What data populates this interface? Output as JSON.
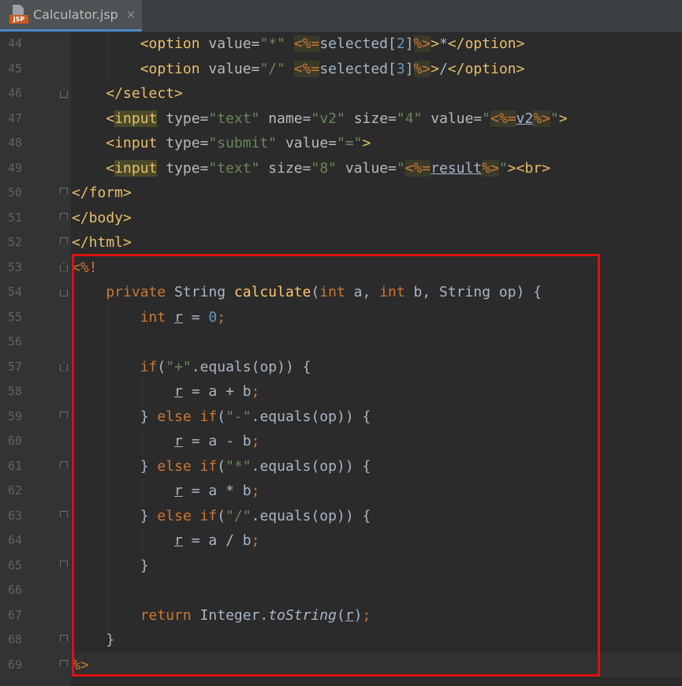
{
  "tab": {
    "title": "Calculator.jsp",
    "close": "✕",
    "icon_label": "JSP"
  },
  "line_numbers": [
    "44",
    "45",
    "46",
    "47",
    "48",
    "49",
    "50",
    "51",
    "52",
    "53",
    "54",
    "55",
    "56",
    "57",
    "58",
    "59",
    "60",
    "61",
    "62",
    "63",
    "64",
    "65",
    "66",
    "67",
    "68",
    "69"
  ],
  "lines": [
    {
      "n": 0,
      "indent": 8,
      "tokens": [
        [
          "tag",
          "<option"
        ],
        [
          "plain",
          " "
        ],
        [
          "attr",
          "value="
        ],
        [
          "str",
          "\"*\""
        ],
        [
          "plain",
          " "
        ],
        [
          "jspd",
          "<%="
        ],
        [
          "plain",
          "selected["
        ],
        [
          "num",
          "2"
        ],
        [
          "plain",
          "]"
        ],
        [
          "jspd",
          "%>"
        ],
        [
          "tag",
          ">"
        ],
        [
          "plain",
          "*"
        ],
        [
          "tag",
          "</option>"
        ]
      ]
    },
    {
      "n": 1,
      "indent": 8,
      "tokens": [
        [
          "tag",
          "<option"
        ],
        [
          "plain",
          " "
        ],
        [
          "attr",
          "value="
        ],
        [
          "str",
          "\"/\""
        ],
        [
          "plain",
          " "
        ],
        [
          "jspd",
          "<%="
        ],
        [
          "plain",
          "selected["
        ],
        [
          "num",
          "3"
        ],
        [
          "plain",
          "]"
        ],
        [
          "jspd",
          "%>"
        ],
        [
          "tag",
          ">"
        ],
        [
          "plain",
          "/"
        ],
        [
          "tag",
          "</option>"
        ]
      ]
    },
    {
      "n": 2,
      "indent": 4,
      "tokens": [
        [
          "tag",
          "</select>"
        ]
      ]
    },
    {
      "n": 3,
      "indent": 4,
      "tokens": [
        [
          "tag",
          "<"
        ],
        [
          "hl tag",
          "input"
        ],
        [
          "plain",
          " "
        ],
        [
          "attr",
          "type="
        ],
        [
          "str",
          "\"text\""
        ],
        [
          "plain",
          " "
        ],
        [
          "attr",
          "name="
        ],
        [
          "str",
          "\"v2\""
        ],
        [
          "plain",
          " "
        ],
        [
          "attr",
          "size="
        ],
        [
          "str",
          "\"4\""
        ],
        [
          "plain",
          " "
        ],
        [
          "attr",
          "value="
        ],
        [
          "str",
          "\""
        ],
        [
          "jspd",
          "<%="
        ],
        [
          "var plain",
          "v2"
        ],
        [
          "jspd",
          "%>"
        ],
        [
          "str",
          "\""
        ],
        [
          "tag",
          ">"
        ]
      ]
    },
    {
      "n": 4,
      "indent": 4,
      "tokens": [
        [
          "tag",
          "<input"
        ],
        [
          "plain",
          " "
        ],
        [
          "attr",
          "type="
        ],
        [
          "str",
          "\"submit\""
        ],
        [
          "plain",
          " "
        ],
        [
          "attr",
          "value="
        ],
        [
          "str",
          "\"=\""
        ],
        [
          "tag",
          ">"
        ]
      ]
    },
    {
      "n": 5,
      "indent": 4,
      "tokens": [
        [
          "tag",
          "<"
        ],
        [
          "hl tag",
          "input"
        ],
        [
          "plain",
          " "
        ],
        [
          "attr",
          "type="
        ],
        [
          "str",
          "\"text\""
        ],
        [
          "plain",
          " "
        ],
        [
          "attr",
          "size="
        ],
        [
          "str",
          "\"8\""
        ],
        [
          "plain",
          " "
        ],
        [
          "attr",
          "value="
        ],
        [
          "str",
          "\""
        ],
        [
          "jspd",
          "<%="
        ],
        [
          "var plain",
          "result"
        ],
        [
          "jspd",
          "%>"
        ],
        [
          "str",
          "\""
        ],
        [
          "tag",
          "><br>"
        ]
      ]
    },
    {
      "n": 6,
      "indent": 0,
      "tokens": [
        [
          "tag",
          "</form>"
        ]
      ]
    },
    {
      "n": 7,
      "indent": 0,
      "tokens": [
        [
          "tag",
          "</body>"
        ]
      ]
    },
    {
      "n": 8,
      "indent": 0,
      "tokens": [
        [
          "tag",
          "</html>"
        ]
      ]
    },
    {
      "n": 9,
      "indent": 0,
      "tokens": [
        [
          "kw",
          "<%!"
        ]
      ]
    },
    {
      "n": 10,
      "indent": 4,
      "tokens": [
        [
          "kw",
          "private"
        ],
        [
          "plain",
          " String "
        ],
        [
          "fn",
          "calculate"
        ],
        [
          "plain",
          "("
        ],
        [
          "kw",
          "int"
        ],
        [
          "plain",
          " a, "
        ],
        [
          "kw",
          "int"
        ],
        [
          "plain",
          " b, String op) {"
        ]
      ]
    },
    {
      "n": 11,
      "indent": 8,
      "tokens": [
        [
          "kw",
          "int"
        ],
        [
          "plain",
          " "
        ],
        [
          "var plain",
          "r"
        ],
        [
          "plain",
          " = "
        ],
        [
          "num",
          "0"
        ],
        [
          "kw",
          ";"
        ]
      ]
    },
    {
      "n": 12,
      "indent": 0,
      "tokens": []
    },
    {
      "n": 13,
      "indent": 8,
      "tokens": [
        [
          "kw",
          "if"
        ],
        [
          "plain",
          "("
        ],
        [
          "str",
          "\"+\""
        ],
        [
          "plain",
          ".equals(op)) {"
        ]
      ]
    },
    {
      "n": 14,
      "indent": 12,
      "tokens": [
        [
          "var plain",
          "r"
        ],
        [
          "plain",
          " = a + b"
        ],
        [
          "kw",
          ";"
        ]
      ]
    },
    {
      "n": 15,
      "indent": 8,
      "tokens": [
        [
          "plain",
          "} "
        ],
        [
          "kw",
          "else if"
        ],
        [
          "plain",
          "("
        ],
        [
          "str",
          "\"-\""
        ],
        [
          "plain",
          ".equals(op)) {"
        ]
      ]
    },
    {
      "n": 16,
      "indent": 12,
      "tokens": [
        [
          "var plain",
          "r"
        ],
        [
          "plain",
          " = a - b"
        ],
        [
          "kw",
          ";"
        ]
      ]
    },
    {
      "n": 17,
      "indent": 8,
      "tokens": [
        [
          "plain",
          "} "
        ],
        [
          "kw",
          "else if"
        ],
        [
          "plain",
          "("
        ],
        [
          "str",
          "\"*\""
        ],
        [
          "plain",
          ".equals(op)) {"
        ]
      ]
    },
    {
      "n": 18,
      "indent": 12,
      "tokens": [
        [
          "var plain",
          "r"
        ],
        [
          "plain",
          " = a * b"
        ],
        [
          "kw",
          ";"
        ]
      ]
    },
    {
      "n": 19,
      "indent": 8,
      "tokens": [
        [
          "plain",
          "} "
        ],
        [
          "kw",
          "else if"
        ],
        [
          "plain",
          "("
        ],
        [
          "str",
          "\"/\""
        ],
        [
          "plain",
          ".equals(op)) {"
        ]
      ]
    },
    {
      "n": 20,
      "indent": 12,
      "tokens": [
        [
          "var plain",
          "r"
        ],
        [
          "plain",
          " = a / b"
        ],
        [
          "kw",
          ";"
        ]
      ]
    },
    {
      "n": 21,
      "indent": 8,
      "tokens": [
        [
          "plain",
          "}"
        ]
      ]
    },
    {
      "n": 22,
      "indent": 0,
      "tokens": []
    },
    {
      "n": 23,
      "indent": 8,
      "tokens": [
        [
          "kw",
          "return"
        ],
        [
          "plain",
          " Integer."
        ],
        [
          "italic plain",
          "toString"
        ],
        [
          "plain",
          "("
        ],
        [
          "var plain",
          "r"
        ],
        [
          "plain",
          ")"
        ],
        [
          "kw",
          ";"
        ]
      ]
    },
    {
      "n": 24,
      "indent": 4,
      "tokens": [
        [
          "plain",
          "}"
        ]
      ]
    },
    {
      "n": 25,
      "indent": 0,
      "tokens": [
        [
          "kw",
          "%>"
        ]
      ]
    }
  ],
  "fold_markers": {
    "top": [
      2,
      9,
      10,
      13
    ],
    "bottom": [
      6,
      7,
      8,
      15,
      17,
      19,
      21,
      24,
      25
    ]
  },
  "colors": {
    "background": "#2b2b2b",
    "gutter": "#313335",
    "highlight_box": "#e01010"
  }
}
